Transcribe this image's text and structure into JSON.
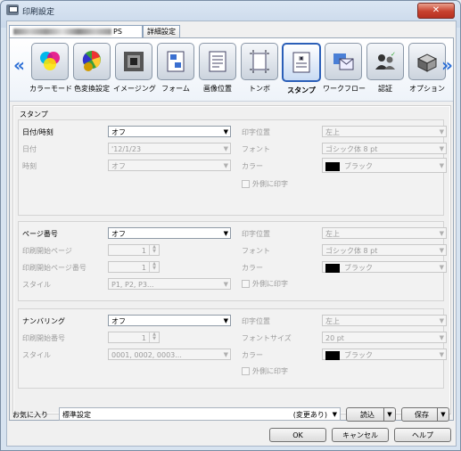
{
  "window": {
    "title": "印刷設定",
    "close_label": "✕"
  },
  "tabs": [
    {
      "label": "PS",
      "active": true
    },
    {
      "label": "詳細設定",
      "active": false
    }
  ],
  "toolbar": {
    "items": [
      {
        "label": "カラーモード",
        "icon": "color-circles-icon"
      },
      {
        "label": "色変換設定",
        "icon": "color-wheel-icon"
      },
      {
        "label": "イメージング",
        "icon": "imaging-icon"
      },
      {
        "label": "フォーム",
        "icon": "form-icon"
      },
      {
        "label": "画像位置",
        "icon": "image-position-icon"
      },
      {
        "label": "トンボ",
        "icon": "crop-marks-icon"
      },
      {
        "label": "スタンプ",
        "icon": "stamp-icon",
        "selected": true
      },
      {
        "label": "ワークフロー",
        "icon": "workflow-icon"
      },
      {
        "label": "認証",
        "icon": "authentication-icon"
      },
      {
        "label": "オプション",
        "icon": "option-icon"
      }
    ]
  },
  "stamp": {
    "section_title": "スタンプ",
    "datetime": {
      "label": "日付/時刻",
      "value": "オフ",
      "date_label": "日付",
      "date_value": "'12/1/23",
      "time_label": "時刻",
      "time_value": "オフ",
      "position_label": "印字位置",
      "position_value": "左上",
      "font_label": "フォント",
      "font_value": "ゴシック体 8 pt",
      "color_label": "カラー",
      "color_value": "ブラック",
      "outside_label": "外側に印字"
    },
    "page_number": {
      "label": "ページ番号",
      "value": "オフ",
      "start_page_label": "印刷開始ページ",
      "start_page_value": "1",
      "start_page_number_label": "印刷開始ページ番号",
      "start_page_number_value": "1",
      "style_label": "スタイル",
      "style_value": "P1, P2, P3...",
      "position_label": "印字位置",
      "position_value": "左上",
      "font_label": "フォント",
      "font_value": "ゴシック体 8 pt",
      "color_label": "カラー",
      "color_value": "ブラック",
      "outside_label": "外側に印字"
    },
    "numbering": {
      "label": "ナンバリング",
      "value": "オフ",
      "start_number_label": "印刷開始番号",
      "start_number_value": "1",
      "style_label": "スタイル",
      "style_value": "0001, 0002, 0003...",
      "position_label": "印字位置",
      "position_value": "左上",
      "font_size_label": "フォントサイズ",
      "font_size_value": "20 pt",
      "color_label": "カラー",
      "color_value": "ブラック",
      "outside_label": "外側に印字"
    }
  },
  "favorites": {
    "label": "お気に入り",
    "value": "標準設定",
    "modified": "(変更あり)",
    "load": "読込",
    "save": "保存"
  },
  "buttons": {
    "ok": "OK",
    "cancel": "キャンセル",
    "help": "ヘルプ"
  },
  "colors": {
    "accent": "#2b5fb8",
    "arrow": "#2c6fd6",
    "close": "#c7412e"
  }
}
